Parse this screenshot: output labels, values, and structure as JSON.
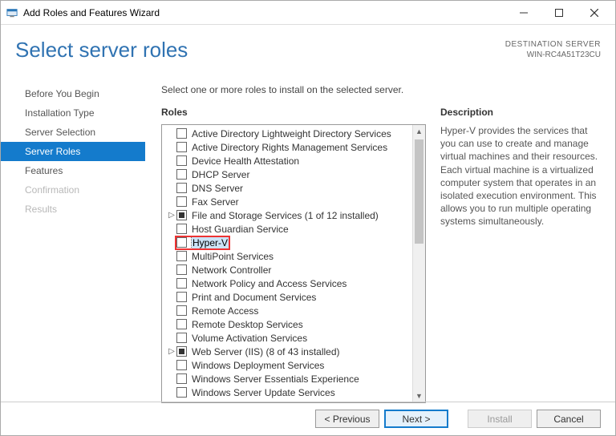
{
  "window": {
    "title": "Add Roles and Features Wizard"
  },
  "header": {
    "page_title": "Select server roles",
    "dest_label": "DESTINATION SERVER",
    "dest_value": "WIN-RC4A51T23CU"
  },
  "sidebar": {
    "items": [
      {
        "label": "Before You Begin",
        "state": "normal"
      },
      {
        "label": "Installation Type",
        "state": "normal"
      },
      {
        "label": "Server Selection",
        "state": "normal"
      },
      {
        "label": "Server Roles",
        "state": "selected"
      },
      {
        "label": "Features",
        "state": "normal"
      },
      {
        "label": "Confirmation",
        "state": "disabled"
      },
      {
        "label": "Results",
        "state": "disabled"
      }
    ]
  },
  "content": {
    "instruction": "Select one or more roles to install on the selected server.",
    "roles_heading": "Roles",
    "desc_heading": "Description",
    "description": "Hyper-V provides the services that you can use to create and manage virtual machines and their resources. Each virtual machine is a virtualized computer system that operates in an isolated execution environment. This allows you to run multiple operating systems simultaneously."
  },
  "roles": [
    {
      "label": "Active Directory Lightweight Directory Services",
      "checked": "none",
      "indent": 0
    },
    {
      "label": "Active Directory Rights Management Services",
      "checked": "none",
      "indent": 0
    },
    {
      "label": "Device Health Attestation",
      "checked": "none",
      "indent": 0
    },
    {
      "label": "DHCP Server",
      "checked": "none",
      "indent": 0
    },
    {
      "label": "DNS Server",
      "checked": "none",
      "indent": 0
    },
    {
      "label": "Fax Server",
      "checked": "none",
      "indent": 0
    },
    {
      "label": "File and Storage Services (1 of 12 installed)",
      "checked": "partial",
      "indent": 0,
      "expandable": true
    },
    {
      "label": "Host Guardian Service",
      "checked": "none",
      "indent": 0
    },
    {
      "label": "Hyper-V",
      "checked": "none",
      "indent": 0,
      "selected": true
    },
    {
      "label": "MultiPoint Services",
      "checked": "none",
      "indent": 0
    },
    {
      "label": "Network Controller",
      "checked": "none",
      "indent": 0
    },
    {
      "label": "Network Policy and Access Services",
      "checked": "none",
      "indent": 0
    },
    {
      "label": "Print and Document Services",
      "checked": "none",
      "indent": 0
    },
    {
      "label": "Remote Access",
      "checked": "none",
      "indent": 0
    },
    {
      "label": "Remote Desktop Services",
      "checked": "none",
      "indent": 0
    },
    {
      "label": "Volume Activation Services",
      "checked": "none",
      "indent": 0
    },
    {
      "label": "Web Server (IIS) (8 of 43 installed)",
      "checked": "partial",
      "indent": 0,
      "expandable": true
    },
    {
      "label": "Windows Deployment Services",
      "checked": "none",
      "indent": 0
    },
    {
      "label": "Windows Server Essentials Experience",
      "checked": "none",
      "indent": 0
    },
    {
      "label": "Windows Server Update Services",
      "checked": "none",
      "indent": 0
    }
  ],
  "footer": {
    "previous": "< Previous",
    "next": "Next >",
    "install": "Install",
    "cancel": "Cancel"
  }
}
